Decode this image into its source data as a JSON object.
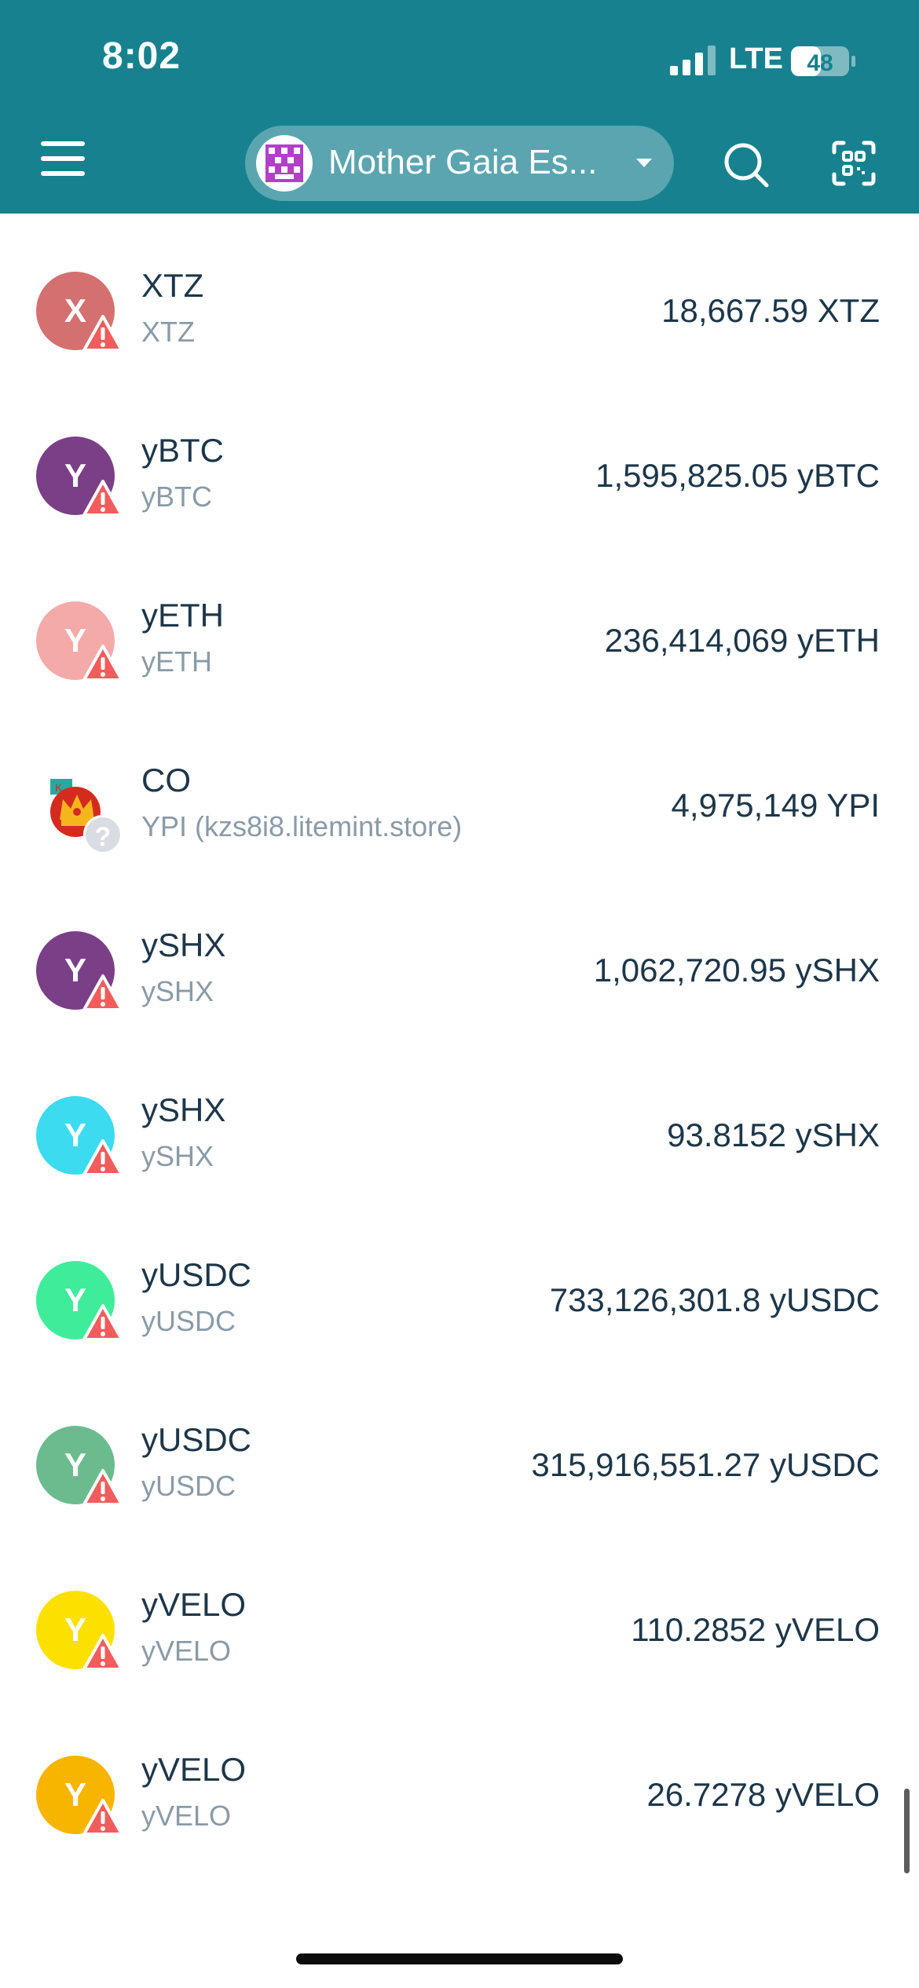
{
  "status_bar": {
    "time": "8:02",
    "network": "LTE",
    "battery": "48"
  },
  "header": {
    "account_name": "Mother Gaia Es...",
    "menu_icon": "hamburger-menu-icon",
    "search_icon": "search-icon",
    "scan_icon": "qr-scan-icon"
  },
  "tokens": [
    {
      "icon_letter": "X",
      "color": "#d4706f",
      "name": "XTZ",
      "subtitle": "XTZ",
      "amount": "18,667.59 XTZ",
      "badge": "warning"
    },
    {
      "icon_letter": "Y",
      "color": "#7a3f86",
      "name": "yBTC",
      "subtitle": "yBTC",
      "amount": "1,595,825.05 yBTC",
      "badge": "warning"
    },
    {
      "icon_letter": "Y",
      "color": "#f4aaa9",
      "name": "yETH",
      "subtitle": "yETH",
      "amount": "236,414,069 yETH",
      "badge": "warning"
    },
    {
      "icon_letter": "",
      "color": "#ffffff",
      "name": "CO",
      "subtitle": "YPI (kzs8i8.litemint.store)",
      "amount": "4,975,149 YPI",
      "badge": "unknown"
    },
    {
      "icon_letter": "Y",
      "color": "#7a3f86",
      "name": "ySHX",
      "subtitle": "ySHX",
      "amount": "1,062,720.95 ySHX",
      "badge": "warning"
    },
    {
      "icon_letter": "Y",
      "color": "#3cdbef",
      "name": "ySHX",
      "subtitle": "ySHX",
      "amount": "93.8152 ySHX",
      "badge": "warning"
    },
    {
      "icon_letter": "Y",
      "color": "#3fec9a",
      "name": "yUSDC",
      "subtitle": "yUSDC",
      "amount": "733,126,301.8 yUSDC",
      "badge": "warning"
    },
    {
      "icon_letter": "Y",
      "color": "#6cbb8f",
      "name": "yUSDC",
      "subtitle": "yUSDC",
      "amount": "315,916,551.27 yUSDC",
      "badge": "warning"
    },
    {
      "icon_letter": "Y",
      "color": "#fbe000",
      "name": "yVELO",
      "subtitle": "yVELO",
      "amount": "110.2852 yVELO",
      "badge": "warning"
    },
    {
      "icon_letter": "Y",
      "color": "#f8b500",
      "name": "yVELO",
      "subtitle": "yVELO",
      "amount": "26.7278 yVELO",
      "badge": "warning"
    }
  ],
  "colors": {
    "header_bg": "#17818f",
    "text_primary": "#1d3649",
    "text_secondary": "#8a9aa7",
    "warning": "#f25c5c"
  }
}
